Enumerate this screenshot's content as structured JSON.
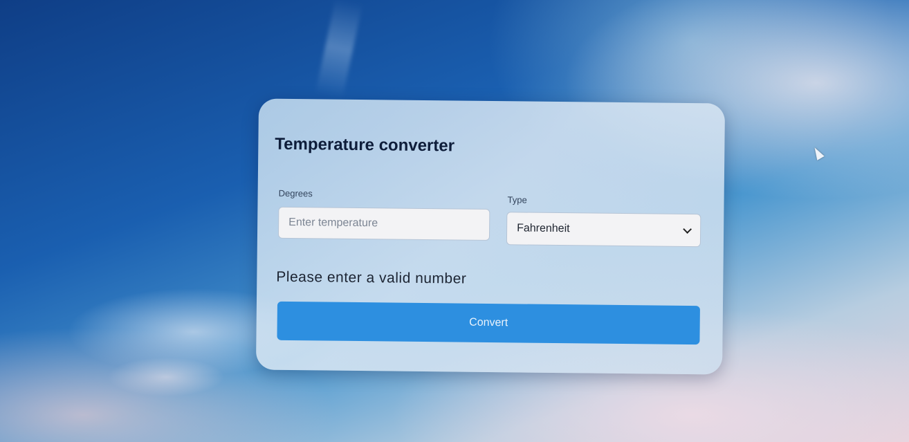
{
  "converter": {
    "title": "Temperature converter",
    "degrees_label": "Degrees",
    "degrees_placeholder": "Enter temperature",
    "degrees_value": "",
    "type_label": "Type",
    "type_selected": "Fahrenheit",
    "error_message": "Please enter a valid number",
    "convert_label": "Convert"
  },
  "colors": {
    "button": "#2d8fe0",
    "card": "#dbe8f4",
    "title_text": "#0e1d3a"
  },
  "icons": {
    "dropdown": "chevron-down-icon",
    "pointer": "mouse-cursor-icon"
  }
}
